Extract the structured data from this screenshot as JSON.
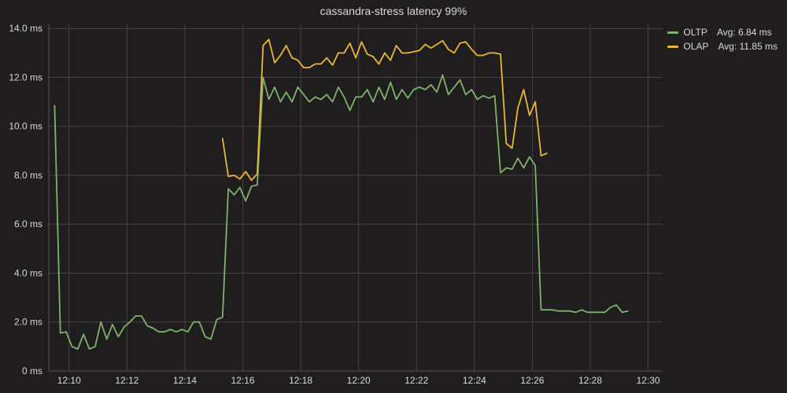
{
  "title": "cassandra-stress latency 99%",
  "legend": [
    {
      "label": "OLTP",
      "stat": "Avg: 6.84 ms",
      "color": "#7EB26D"
    },
    {
      "label": "OLAP",
      "stat": "Avg: 11.85 ms",
      "color": "#EAB839"
    }
  ],
  "chart_data": {
    "type": "line",
    "xlabel": "",
    "ylabel": "",
    "y_unit": "ms",
    "ylim": [
      0,
      14.2
    ],
    "xlim": [
      729.3,
      750.5
    ],
    "y_ticks": [
      0,
      2,
      4,
      6,
      8,
      10,
      12,
      14
    ],
    "y_tick_labels": [
      "0 ms",
      "2.0 ms",
      "4.0 ms",
      "6.0 ms",
      "8.0 ms",
      "10.0 ms",
      "12.0 ms",
      "14.0 ms"
    ],
    "x_ticks": [
      730,
      732,
      734,
      736,
      738,
      740,
      742,
      744,
      746,
      748,
      750
    ],
    "x_tick_labels": [
      "12:10",
      "12:12",
      "12:14",
      "12:16",
      "12:18",
      "12:20",
      "12:22",
      "12:24",
      "12:26",
      "12:28",
      "12:30"
    ],
    "series": [
      {
        "name": "OLTP",
        "color": "#7EB26D",
        "x": [
          729.5,
          729.7,
          729.9,
          730.1,
          730.3,
          730.5,
          730.7,
          730.9,
          731.1,
          731.3,
          731.5,
          731.7,
          731.9,
          732.1,
          732.3,
          732.5,
          732.7,
          732.9,
          733.1,
          733.3,
          733.5,
          733.7,
          733.9,
          734.1,
          734.3,
          734.5,
          734.7,
          734.9,
          735.1,
          735.3,
          735.5,
          735.7,
          735.9,
          736.1,
          736.3,
          736.5,
          736.7,
          736.9,
          737.1,
          737.3,
          737.5,
          737.7,
          737.9,
          738.1,
          738.3,
          738.5,
          738.7,
          738.9,
          739.1,
          739.3,
          739.5,
          739.7,
          739.9,
          740.1,
          740.3,
          740.5,
          740.7,
          740.9,
          741.1,
          741.3,
          741.5,
          741.7,
          741.9,
          742.1,
          742.3,
          742.5,
          742.7,
          742.9,
          743.1,
          743.3,
          743.5,
          743.7,
          743.9,
          744.1,
          744.3,
          744.5,
          744.7,
          744.9,
          745.1,
          745.3,
          745.5,
          745.7,
          745.9,
          746.1,
          746.3,
          746.5,
          746.7,
          746.9,
          747.1,
          747.3,
          747.5,
          747.7,
          747.9,
          748.1,
          748.3,
          748.5,
          748.7,
          748.9,
          749.1,
          749.3
        ],
        "y": [
          10.85,
          1.55,
          1.6,
          1.0,
          0.9,
          1.5,
          0.9,
          1.0,
          2.0,
          1.3,
          1.9,
          1.4,
          1.8,
          2.0,
          2.25,
          2.25,
          1.85,
          1.75,
          1.6,
          1.6,
          1.7,
          1.6,
          1.7,
          1.6,
          2.0,
          2.0,
          1.4,
          1.3,
          2.1,
          2.2,
          7.45,
          7.2,
          7.5,
          6.95,
          7.55,
          7.6,
          12.0,
          11.1,
          11.6,
          11.0,
          11.4,
          11.0,
          11.6,
          11.3,
          11.0,
          11.2,
          11.1,
          11.3,
          11.0,
          11.6,
          11.2,
          10.65,
          11.2,
          11.2,
          11.5,
          11.0,
          11.6,
          11.1,
          11.8,
          11.1,
          11.5,
          11.15,
          11.5,
          11.6,
          11.5,
          11.7,
          11.4,
          12.1,
          11.3,
          11.6,
          11.9,
          11.3,
          11.5,
          11.1,
          11.25,
          11.15,
          11.25,
          8.1,
          8.3,
          8.25,
          8.7,
          8.3,
          8.75,
          8.4,
          2.5,
          2.5,
          2.5,
          2.45,
          2.45,
          2.45,
          2.4,
          2.5,
          2.4,
          2.4,
          2.4,
          2.4,
          2.6,
          2.7,
          2.4,
          2.45
        ]
      },
      {
        "name": "OLAP",
        "color": "#EAB839",
        "x": [
          735.3,
          735.5,
          735.7,
          735.9,
          736.1,
          736.3,
          736.5,
          736.7,
          736.9,
          737.1,
          737.3,
          737.5,
          737.7,
          737.9,
          738.1,
          738.3,
          738.5,
          738.7,
          738.9,
          739.1,
          739.3,
          739.5,
          739.7,
          739.9,
          740.1,
          740.3,
          740.5,
          740.7,
          740.9,
          741.1,
          741.3,
          741.5,
          741.7,
          741.9,
          742.1,
          742.3,
          742.5,
          742.7,
          742.9,
          743.1,
          743.3,
          743.5,
          743.7,
          743.9,
          744.1,
          744.3,
          744.5,
          744.7,
          744.9,
          745.1,
          745.3,
          745.5,
          745.7,
          745.9,
          746.1,
          746.3,
          746.5
        ],
        "y": [
          9.5,
          7.95,
          8.0,
          7.85,
          8.15,
          7.8,
          8.05,
          13.3,
          13.55,
          12.6,
          12.9,
          13.3,
          12.8,
          12.7,
          12.4,
          12.4,
          12.55,
          12.55,
          12.8,
          12.5,
          13.0,
          13.0,
          13.4,
          12.8,
          13.45,
          12.95,
          12.85,
          12.55,
          13.0,
          12.7,
          13.3,
          13.0,
          13.0,
          13.05,
          13.1,
          13.35,
          13.2,
          13.35,
          13.5,
          13.15,
          13.0,
          13.4,
          13.45,
          13.15,
          12.9,
          12.9,
          13.0,
          13.0,
          12.95,
          9.3,
          9.1,
          10.75,
          11.5,
          10.45,
          11.0,
          8.8,
          8.9
        ]
      }
    ]
  }
}
